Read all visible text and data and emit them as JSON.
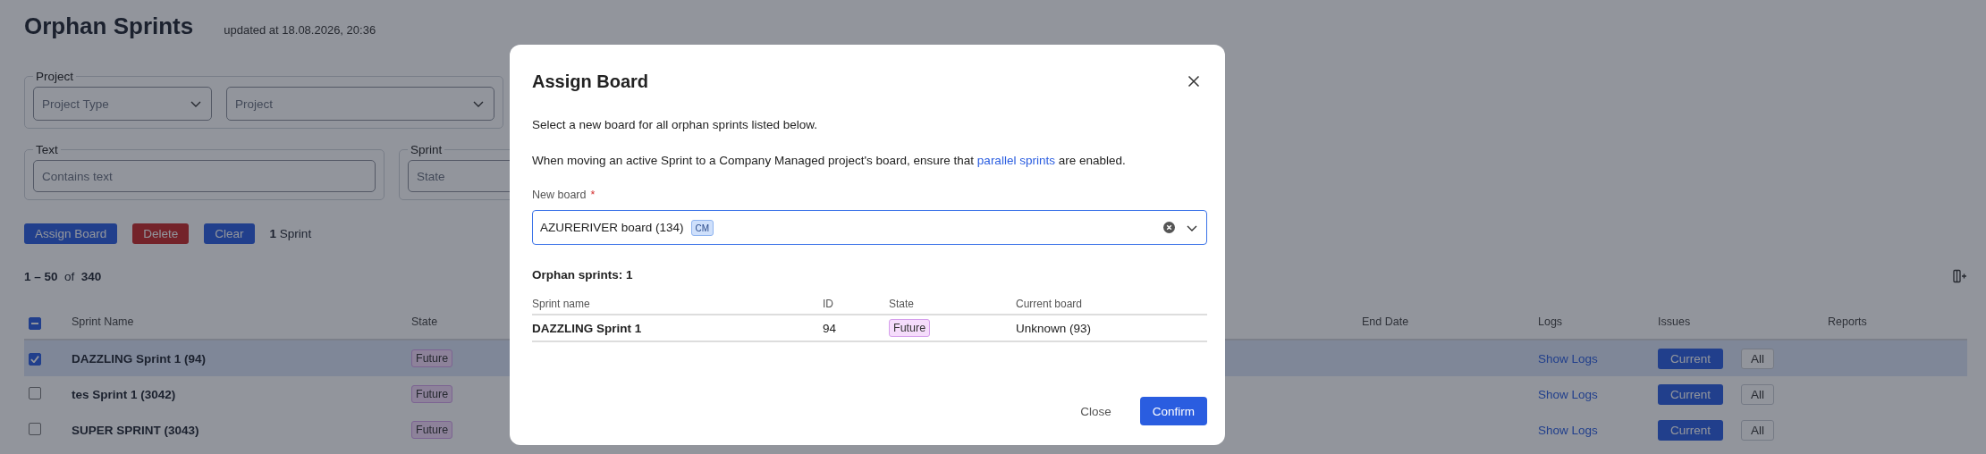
{
  "page": {
    "title": "Orphan Sprints",
    "updated": "updated at 18.08.2026, 20:36"
  },
  "filters": [
    {
      "legend": "Project",
      "fields": [
        {
          "kind": "select",
          "placeholder": "Project Type"
        },
        {
          "kind": "select",
          "placeholder": "Project"
        }
      ]
    },
    {
      "legend": "Text",
      "fields": [
        {
          "kind": "text",
          "placeholder": "Contains text"
        }
      ]
    },
    {
      "legend": "Sprint",
      "fields": [
        {
          "kind": "text",
          "placeholder": "State"
        }
      ]
    }
  ],
  "actions": [
    {
      "kind": "primary",
      "label": "Assign Board"
    },
    {
      "kind": "danger",
      "label": "Delete"
    },
    {
      "kind": "primary",
      "label": "Clear"
    }
  ],
  "selection_summary": "**1** Sprint",
  "pagination": "**1 – 50**  of  **340**",
  "table": {
    "select_all": {
      "indeterminate": true
    },
    "columns": [
      {
        "label": "Sprint Name"
      },
      {
        "label": "State"
      },
      {
        "label": "End Date"
      },
      {
        "label": "Logs"
      },
      {
        "label": "Issues"
      },
      {
        "label": "Reports"
      }
    ],
    "rows": [
      {
        "name": "DAZZLING Sprint 1 (94)",
        "state": "Future",
        "selected": true,
        "logs": "Show Logs",
        "issues": [
          {
            "kind": "primary",
            "label": "Current"
          },
          {
            "kind": "outline",
            "label": "All"
          }
        ]
      },
      {
        "name": "tes Sprint 1 (3042)",
        "state": "Future",
        "selected": false,
        "logs": "Show Logs",
        "issues": [
          {
            "kind": "primary",
            "label": "Current"
          },
          {
            "kind": "outline",
            "label": "All"
          }
        ]
      },
      {
        "name": "SUPER SPRINT (3043)",
        "state": "Future",
        "selected": false,
        "logs": "Show Logs",
        "issues": [
          {
            "kind": "primary",
            "label": "Current"
          },
          {
            "kind": "outline",
            "label": "All"
          }
        ]
      }
    ]
  },
  "modal": {
    "title": "Assign Board",
    "intro": "Select a new board for all orphan sprints listed below.",
    "note": {
      "before": "When moving an active Sprint to a Company Managed project's board, ensure that ",
      "link": "parallel sprints",
      "after": " are enabled."
    },
    "field": {
      "label": "New board",
      "required_mark": "*",
      "value": "AZURERIVER board (134)",
      "tag": "CM",
      "focused": true
    },
    "section_title": "Orphan sprints: 1",
    "columns": [
      "Sprint name",
      "ID",
      "State",
      "Current board"
    ],
    "rows": [
      {
        "name": "DAZZLING Sprint 1",
        "id": "94",
        "state": "Future",
        "board": "Unknown (93)"
      }
    ],
    "buttons": [
      {
        "kind": "plain",
        "label": "Close"
      },
      {
        "kind": "primary",
        "label": "Confirm"
      }
    ]
  }
}
